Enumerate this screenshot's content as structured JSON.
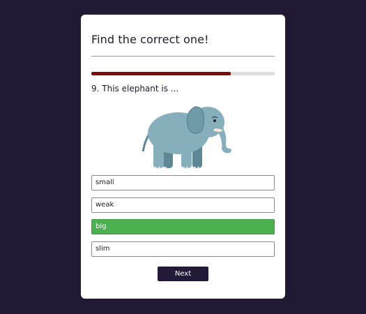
{
  "quiz": {
    "title": "Find the correct one!",
    "progress": 0.76,
    "question": "9. This elephant is ...",
    "image_icon": "elephant-illustration",
    "options": [
      {
        "label": "small",
        "state": "default"
      },
      {
        "label": "weak",
        "state": "default"
      },
      {
        "label": "big",
        "state": "correct"
      },
      {
        "label": "slim",
        "state": "default"
      }
    ],
    "next_label": "Next"
  },
  "colors": {
    "background": "#221a35",
    "card": "#ffffff",
    "progress_fill": "#7d0a0a",
    "progress_track": "#dedede",
    "correct": "#4caf50",
    "button": "#231a38"
  }
}
